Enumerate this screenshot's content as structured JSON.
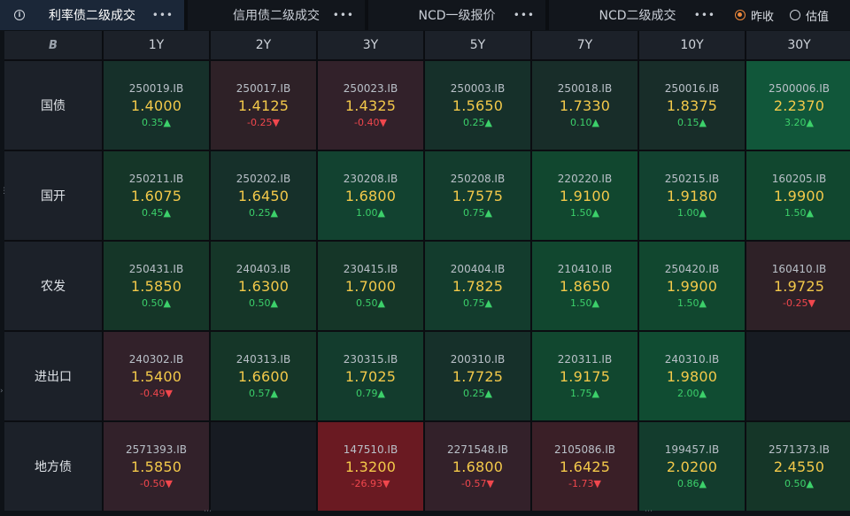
{
  "tabs": [
    {
      "label": "利率债二级成交",
      "active": true,
      "width": 208
    },
    {
      "label": "信用债二级成交",
      "active": false,
      "width": 200
    },
    {
      "label": "NCD一级报价",
      "active": false,
      "width": 200
    },
    {
      "label": "NCD二级成交",
      "active": false,
      "width": 200
    }
  ],
  "more_glyph": "•••",
  "radio": {
    "options": [
      {
        "label": "昨收",
        "checked": true
      },
      {
        "label": "估值",
        "checked": false
      }
    ]
  },
  "corner_glyph": "B",
  "columns": [
    "1Y",
    "2Y",
    "3Y",
    "5Y",
    "7Y",
    "10Y",
    "30Y"
  ],
  "rows": [
    {
      "label": "国债",
      "cells": [
        {
          "code": "250019.IB",
          "yield": "1.4000",
          "change": "0.35▲",
          "dir": "up",
          "bg": "#16302a"
        },
        {
          "code": "250017.IB",
          "yield": "1.4125",
          "change": "-0.25▼",
          "dir": "down",
          "bg": "#2e2127"
        },
        {
          "code": "250023.IB",
          "yield": "1.4325",
          "change": "-0.40▼",
          "dir": "down",
          "bg": "#32212a"
        },
        {
          "code": "250003.IB",
          "yield": "1.5650",
          "change": "0.25▲",
          "dir": "up",
          "bg": "#16302a"
        },
        {
          "code": "250018.IB",
          "yield": "1.7330",
          "change": "0.10▲",
          "dir": "up",
          "bg": "#182d29"
        },
        {
          "code": "250016.IB",
          "yield": "1.8375",
          "change": "0.15▲",
          "dir": "up",
          "bg": "#182d29"
        },
        {
          "code": "2500006.IB",
          "yield": "2.2370",
          "change": "3.20▲",
          "dir": "up",
          "bg": "#11573a"
        }
      ]
    },
    {
      "label": "国开",
      "cells": [
        {
          "code": "250211.IB",
          "yield": "1.6075",
          "change": "0.45▲",
          "dir": "up",
          "bg": "#153628"
        },
        {
          "code": "250202.IB",
          "yield": "1.6450",
          "change": "0.25▲",
          "dir": "up",
          "bg": "#16302a"
        },
        {
          "code": "230208.IB",
          "yield": "1.6800",
          "change": "1.00▲",
          "dir": "up",
          "bg": "#124230"
        },
        {
          "code": "250208.IB",
          "yield": "1.7575",
          "change": "0.75▲",
          "dir": "up",
          "bg": "#133c2d"
        },
        {
          "code": "220220.IB",
          "yield": "1.9100",
          "change": "1.50▲",
          "dir": "up",
          "bg": "#11472f"
        },
        {
          "code": "250215.IB",
          "yield": "1.9180",
          "change": "1.00▲",
          "dir": "up",
          "bg": "#124230"
        },
        {
          "code": "160205.IB",
          "yield": "1.9900",
          "change": "1.50▲",
          "dir": "up",
          "bg": "#11472f"
        }
      ]
    },
    {
      "label": "农发",
      "cells": [
        {
          "code": "250431.IB",
          "yield": "1.5850",
          "change": "0.50▲",
          "dir": "up",
          "bg": "#153628"
        },
        {
          "code": "240403.IB",
          "yield": "1.6300",
          "change": "0.50▲",
          "dir": "up",
          "bg": "#153628"
        },
        {
          "code": "230415.IB",
          "yield": "1.7000",
          "change": "0.50▲",
          "dir": "up",
          "bg": "#153628"
        },
        {
          "code": "200404.IB",
          "yield": "1.7825",
          "change": "0.75▲",
          "dir": "up",
          "bg": "#133c2d"
        },
        {
          "code": "210410.IB",
          "yield": "1.8650",
          "change": "1.50▲",
          "dir": "up",
          "bg": "#11472f"
        },
        {
          "code": "250420.IB",
          "yield": "1.9900",
          "change": "1.50▲",
          "dir": "up",
          "bg": "#11472f"
        },
        {
          "code": "160410.IB",
          "yield": "1.9725",
          "change": "-0.25▼",
          "dir": "down",
          "bg": "#2e2127"
        }
      ]
    },
    {
      "label": "进出口",
      "cells": [
        {
          "code": "240302.IB",
          "yield": "1.5400",
          "change": "-0.49▼",
          "dir": "down",
          "bg": "#32212a"
        },
        {
          "code": "240313.IB",
          "yield": "1.6600",
          "change": "0.57▲",
          "dir": "up",
          "bg": "#153628"
        },
        {
          "code": "230315.IB",
          "yield": "1.7025",
          "change": "0.79▲",
          "dir": "up",
          "bg": "#133c2d"
        },
        {
          "code": "200310.IB",
          "yield": "1.7725",
          "change": "0.25▲",
          "dir": "up",
          "bg": "#16302a"
        },
        {
          "code": "220311.IB",
          "yield": "1.9175",
          "change": "1.75▲",
          "dir": "up",
          "bg": "#11472f"
        },
        {
          "code": "240310.IB",
          "yield": "1.9800",
          "change": "2.00▲",
          "dir": "up",
          "bg": "#104c32"
        },
        {
          "code": "",
          "yield": "",
          "change": "",
          "dir": "none",
          "bg": "#171b22"
        }
      ]
    },
    {
      "label": "地方债",
      "cells": [
        {
          "code": "2571393.IB",
          "yield": "1.5850",
          "change": "-0.50▼",
          "dir": "down",
          "bg": "#32212a"
        },
        {
          "code": "",
          "yield": "",
          "change": "",
          "dir": "none",
          "bg": "#171b22"
        },
        {
          "code": "147510.IB",
          "yield": "1.3200",
          "change": "-26.93▼",
          "dir": "down",
          "bg": "#6a1a22"
        },
        {
          "code": "2271548.IB",
          "yield": "1.6800",
          "change": "-0.57▼",
          "dir": "down",
          "bg": "#33212a"
        },
        {
          "code": "2105086.IB",
          "yield": "1.6425",
          "change": "-1.73▼",
          "dir": "down",
          "bg": "#3a1f27"
        },
        {
          "code": "199457.IB",
          "yield": "2.0200",
          "change": "0.86▲",
          "dir": "up",
          "bg": "#133c2d"
        },
        {
          "code": "2571373.IB",
          "yield": "2.4550",
          "change": "0.50▲",
          "dir": "up",
          "bg": "#153628"
        }
      ]
    }
  ]
}
